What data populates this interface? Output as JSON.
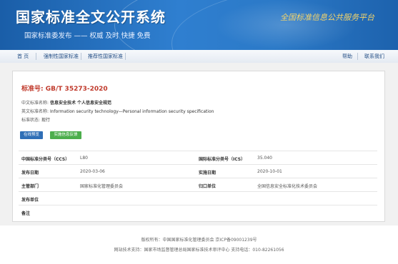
{
  "header": {
    "site_title": "国家标准全文公开系统",
    "site_subtitle": "国家标准委发布 —— 权威 及时 快捷 免费",
    "slogan": "全国标准信息公共服务平台"
  },
  "nav": {
    "items": [
      "首 页",
      "强制性国家标准",
      "推荐性国家标准"
    ],
    "right_items": [
      "帮助",
      "联系我们"
    ]
  },
  "standard": {
    "number_label": "标准号:",
    "number": "GB/T 35273-2020",
    "cn_name_label": "中文标准名称:",
    "cn_name": "信息安全技术 个人信息安全规范",
    "en_name_label": "英文标准名称:",
    "en_name": "Information security technology—Personal information security specification",
    "status_label": "标准状态:",
    "status": "现行"
  },
  "buttons": {
    "preview": "在线预览",
    "feedback": "实施信息反馈"
  },
  "details": {
    "ccs_label": "中国标准分类号（CCS）",
    "ccs_value": "L80",
    "ics_label": "国际标准分类号（ICS）",
    "ics_value": "35.040",
    "publish_date_label": "发布日期",
    "publish_date": "2020-03-06",
    "impl_date_label": "实施日期",
    "impl_date": "2020-10-01",
    "authority_label": "主管部门",
    "authority": "国家标准化管理委员会",
    "owner_label": "归口单位",
    "owner": "全国信息安全标准化技术委员会",
    "issuer_label": "发布单位",
    "issuer": "",
    "remark_label": "备注",
    "remark": ""
  },
  "footer": {
    "line1": "版权所有：中国国家标准化管理委员会 京ICP备09001239号",
    "line2": "网站技术支持：国家市场监督管理总局国家标准技术审评中心 支持电话：010-82261056"
  }
}
